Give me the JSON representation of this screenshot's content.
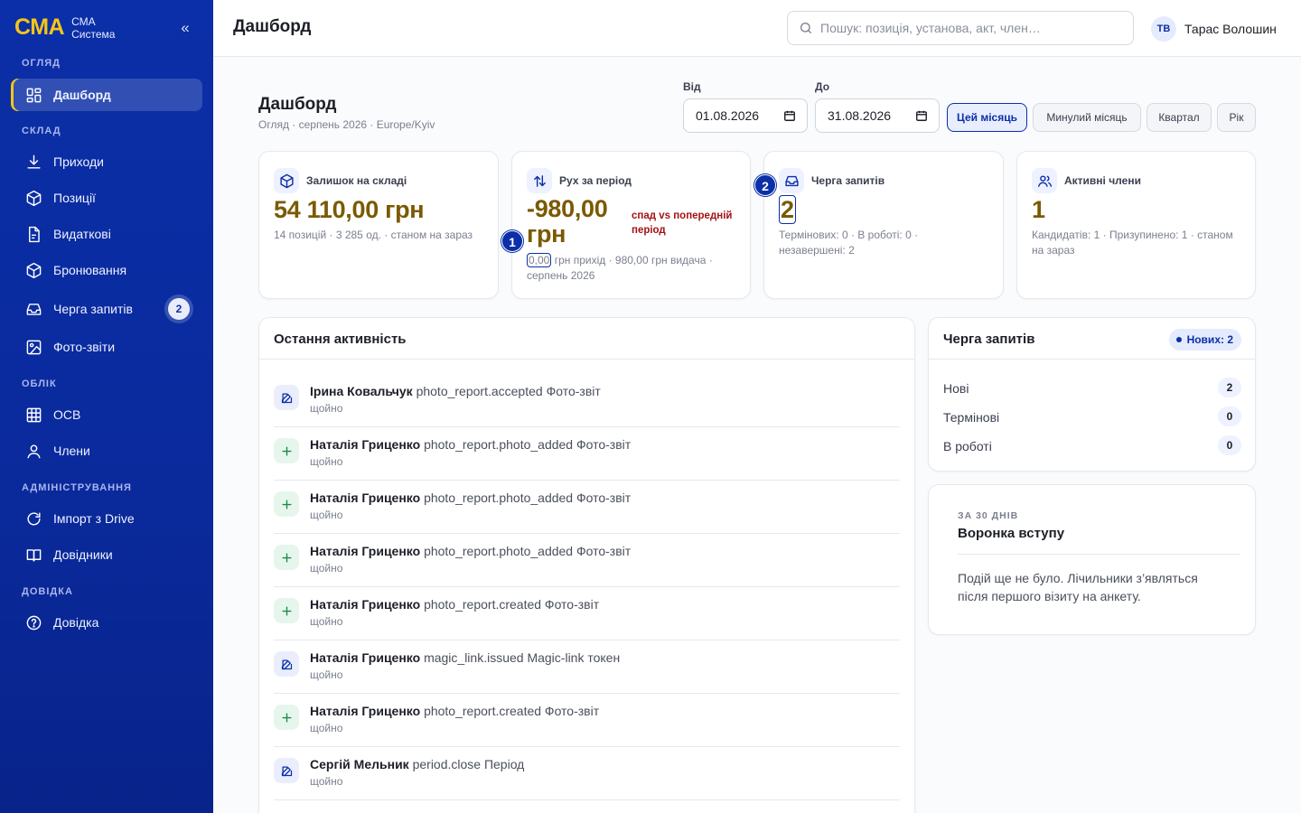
{
  "brand": {
    "logo": "СМА",
    "line1": "СМА",
    "line2": "Система",
    "collapse": "«"
  },
  "sidebar": {
    "sections": [
      {
        "label": "ОГЛЯД"
      },
      {
        "label": "СКЛАД"
      },
      {
        "label": "ОБЛІК"
      },
      {
        "label": "АДМІНІСТРУВАННЯ"
      },
      {
        "label": "ДОВІДКА"
      }
    ],
    "items": [
      {
        "label": "Дашборд",
        "icon": "dashboard-icon",
        "active": true
      },
      {
        "label": "Приходи",
        "icon": "download-icon"
      },
      {
        "label": "Позиції",
        "icon": "box-icon"
      },
      {
        "label": "Видаткові",
        "icon": "document-icon"
      },
      {
        "label": "Бронювання",
        "icon": "box-icon"
      },
      {
        "label": "Черга запитів",
        "icon": "inbox-icon",
        "badge": "2"
      },
      {
        "label": "Фото-звіти",
        "icon": "image-icon"
      },
      {
        "label": "ОСВ",
        "icon": "table-icon"
      },
      {
        "label": "Члени",
        "icon": "user-icon"
      },
      {
        "label": "Імпорт з Drive",
        "icon": "refresh-icon"
      },
      {
        "label": "Довідники",
        "icon": "book-icon"
      },
      {
        "label": "Довідка",
        "icon": "help-icon"
      }
    ]
  },
  "topbar": {
    "title": "Дашборд",
    "search_placeholder": "Пошук: позиція, установа, акт, член…",
    "user_initials": "ТВ",
    "user_name": "Тарас Волошин"
  },
  "header": {
    "title": "Дашборд",
    "subtitle": "Огляд · серпень 2026 · Europe/Kyiv",
    "from_label": "Від",
    "from_value": "01.08.2026",
    "to_label": "До",
    "to_value": "31.08.2026",
    "periods": [
      {
        "label": "Цей місяць",
        "active": true
      },
      {
        "label": "Минулий місяць"
      },
      {
        "label": "Квартал"
      },
      {
        "label": "Рік"
      }
    ]
  },
  "kpis": [
    {
      "label": "Залишок на складі",
      "icon": "box-icon",
      "value": "54 110,00 грн",
      "sub": "14 позицій · 3 285 од. · станом на зараз"
    },
    {
      "label": "Рух за період",
      "icon": "arrows-updown-icon",
      "value_line1": "-980,00",
      "value_line2": "грн",
      "delta": "спад vs попередній період",
      "sub_value": "0,00",
      "sub_rest": " грн прихід · 980,00 грн видача ·",
      "sub_line2": "серпень 2026",
      "marker": "1"
    },
    {
      "label": "Черга запитів",
      "icon": "inbox-icon",
      "value": "2",
      "sub": "Термінових: 0 · В роботі: 0 · незавершені: 2",
      "marker": "2"
    },
    {
      "label": "Активні члени",
      "icon": "users-icon",
      "value": "1",
      "sub": "Кандидатів: 1 · Призупинено: 1 · станом на зараз"
    }
  ],
  "activity": {
    "title": "Остання активність",
    "items": [
      {
        "type": "edit",
        "user": "Ірина Ковальчук",
        "action": "photo_report.accepted Фото-звіт",
        "time": "щойно"
      },
      {
        "type": "add",
        "user": "Наталія Гриценко",
        "action": "photo_report.photo_added Фото-звіт",
        "time": "щойно"
      },
      {
        "type": "add",
        "user": "Наталія Гриценко",
        "action": "photo_report.photo_added Фото-звіт",
        "time": "щойно"
      },
      {
        "type": "add",
        "user": "Наталія Гриценко",
        "action": "photo_report.photo_added Фото-звіт",
        "time": "щойно"
      },
      {
        "type": "add",
        "user": "Наталія Гриценко",
        "action": "photo_report.created Фото-звіт",
        "time": "щойно"
      },
      {
        "type": "edit",
        "user": "Наталія Гриценко",
        "action": "magic_link.issued Magic-link токен",
        "time": "щойно"
      },
      {
        "type": "add",
        "user": "Наталія Гриценко",
        "action": "photo_report.created Фото-звіт",
        "time": "щойно"
      },
      {
        "type": "edit",
        "user": "Сергій Мельник",
        "action": "period.close Період",
        "time": "щойно"
      }
    ]
  },
  "queue": {
    "title": "Черга запитів",
    "badge": "Нових: 2",
    "rows": [
      {
        "label": "Нові",
        "count": "2"
      },
      {
        "label": "Термінові",
        "count": "0"
      },
      {
        "label": "В роботі",
        "count": "0"
      }
    ]
  },
  "funnel": {
    "kicker": "ЗА 30 ДНІВ",
    "title": "Воронка вступу",
    "text": "Подій ще не було. Лічильники з’являться після першого візиту на анкету."
  }
}
